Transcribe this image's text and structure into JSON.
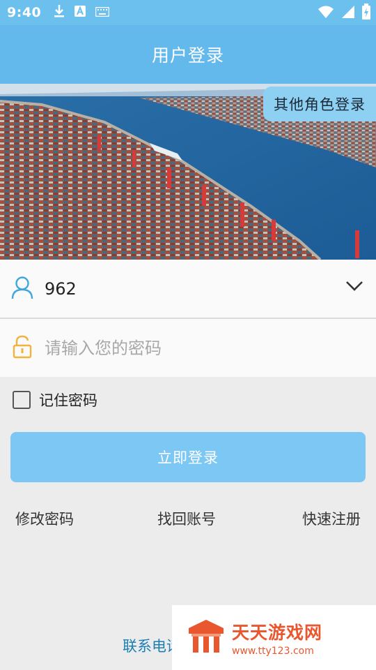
{
  "status_bar": {
    "time": "9:40",
    "left_icons": [
      "download-icon",
      "a-icon",
      "keyboard-icon"
    ],
    "right_icons": [
      "wifi-icon",
      "signal-icon",
      "battery-icon"
    ]
  },
  "header": {
    "title": "用户登录"
  },
  "banner": {
    "role_button": "其他角色登录"
  },
  "form": {
    "account_value": "962",
    "password_placeholder": "请输入您的密码",
    "remember_label": "记住密码",
    "login_button": "立即登录"
  },
  "links": {
    "change_password": "修改密码",
    "recover_account": "找回账号",
    "quick_register": "快速注册"
  },
  "footer": {
    "contact": "联系电话"
  },
  "watermark": {
    "name": "天天游戏网",
    "url": "www.tty123.com"
  },
  "colors": {
    "primary": "#63b8ec",
    "button": "#7cc7f4",
    "watermark": "#e9572f"
  }
}
